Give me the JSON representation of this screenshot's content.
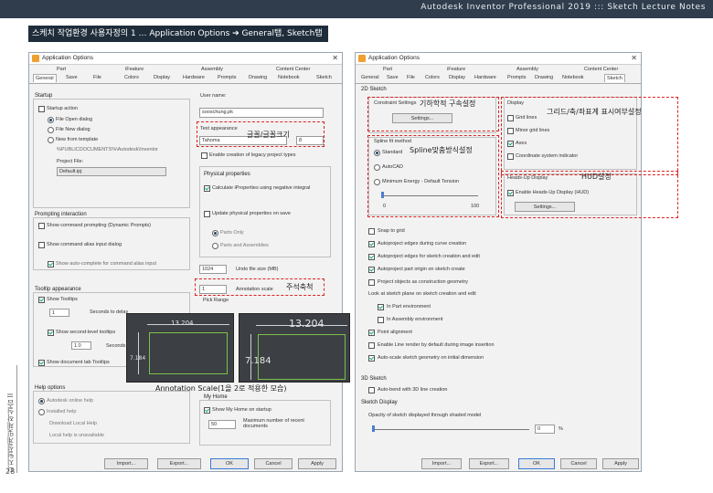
{
  "header": {
    "title": "Autodesk Inventor Professional 2019 ::: Sketch Lecture Notes"
  },
  "slide": {
    "heading": "스케치 작업환경 사용자정의 1 … Application Options ➔ General탭, Sketch탭",
    "sidebar_text": "디지털설계및제작실습 II",
    "page_number": "28"
  },
  "left_dialog": {
    "title": "Application Options",
    "close": "✕",
    "tabs_row1": [
      "Part",
      "iFeature",
      "Assembly",
      "Content Center"
    ],
    "tabs_row2": [
      "General",
      "Save",
      "File",
      "Colors",
      "Display",
      "Hardware",
      "Prompts",
      "Drawing",
      "Notebook",
      "Sketch"
    ],
    "startup": {
      "group": "Startup",
      "startup_action": "Startup action",
      "file_open": "File Open dialog",
      "file_new": "File New dialog",
      "new_from_template": "New from template",
      "template_path": "%PUBLICDOCUMENTS%\\Autodesk\\Inventor",
      "project_file_label": "Project File:",
      "project_file_value": "Default.ipj"
    },
    "user_name_label": "User name:",
    "user_name_value": "sooschung.pk",
    "text_appearance_label": "Text appearance",
    "font_value": "Tahoma",
    "font_size": "8",
    "enable_creation_label": "Enable creation of legacy project types",
    "physical_props": {
      "group": "Physical properties",
      "calc_label": "Calculate iProperties using negative integral",
      "update_label": "Update physical properties on save",
      "parts_only": "Parts Only",
      "parts_assemblies": "Parts and Assemblies"
    },
    "prompting": {
      "group": "Prompting interaction",
      "show_command": "Show command prompting (Dynamic Prompts)",
      "show_command_alias": "Show command alias input dialog",
      "show_auto_complete": "Show auto-complete for command alias input"
    },
    "undo_value": "1024",
    "undo_label": "Undo file size (MB)",
    "annotation_scale_value": "1",
    "annotation_scale_label": "Annotation scale",
    "pick_range": "Pick Range",
    "tooltip": {
      "group": "Tooltip appearance",
      "show_tooltips": "Show Tooltips",
      "delay_value": "1",
      "seconds_delay": "Seconds to delay",
      "show_second_level": "Show second-level tooltips",
      "delay2_value": "1.0",
      "seconds_delay2": "Seconds to delay",
      "show_doc_tab": "Show document tab Tooltips"
    },
    "help": {
      "group": "Help options",
      "autodesk_help": "Autodesk online help",
      "installed_help": "Installed help",
      "download_help": "Download Local Help",
      "local_help_note": "Local help is unavailable"
    },
    "my_home": {
      "group": "My Home",
      "show_my_home": "Show My Home on startup",
      "recent_value": "50",
      "recent_label": "Maximum number of recent documents"
    },
    "buttons": {
      "import": "Import...",
      "export": "Export...",
      "ok": "OK",
      "cancel": "Cancel",
      "apply": "Apply"
    }
  },
  "right_dialog": {
    "title": "Application Options",
    "close": "✕",
    "tabs_row1": [
      "Part",
      "iFeature",
      "Assembly",
      "Content Center"
    ],
    "tabs_row2": [
      "General",
      "Save",
      "File",
      "Colors",
      "Display",
      "Hardware",
      "Prompts",
      "Drawing",
      "Notebook",
      "Sketch"
    ],
    "sketch_2d": "2D Sketch",
    "constraint_settings": "Constraint Settings",
    "settings_btn": "Settings...",
    "display_group": "Display",
    "grid_lines": "Grid lines",
    "minor_grid": "Minor grid lines",
    "axes": "Axes",
    "coord_indicator": "Coordinate system indicator",
    "spline_fit": "Spline fit method",
    "standard": "Standard",
    "autocad": "AutoCAD",
    "min_energy": "Minimum Energy - Default Tension",
    "slider_min": "0",
    "slider_max": "100",
    "hud_group": "Heads-Up Display",
    "enable_hud": "Enable Heads-Up Display (HUD)",
    "hud_settings": "Settings...",
    "snap_to_grid": "Snap to grid",
    "options": [
      "Autoproject edges during curve creation",
      "Autoproject edges for sketch creation and edit",
      "Autoproject part origin on sketch create",
      "Project objects as construction geometry",
      "Look at sketch plane on sketch creation and edit",
      "In Part environment",
      "In Assembly environment",
      "Point alignment",
      "Enable Line render by default during image insertion",
      "Auto-scale sketch geometry on initial dimension"
    ],
    "sketch_3d": "3D Sketch",
    "auto_bend": "Auto-bend with 3D line creation",
    "sketch_display": "Sketch Display",
    "opacity_label": "Opacity of sketch displayed through shaded model",
    "opacity_value": "0",
    "opacity_unit": "%",
    "buttons": {
      "import": "Import...",
      "export": "Export...",
      "ok": "OK",
      "cancel": "Cancel",
      "apply": "Apply"
    }
  },
  "annotations": {
    "constraint": "기하학적 구속설정",
    "grid": "그리드/축/좌표계 표시여부설정",
    "font": "글꼴/글꼴크기",
    "spline": "Spline맞춤방식설정",
    "hud": "HUD설정",
    "annotation": "주석축척",
    "annotation_caption": "Annotation Scale(1을 2로 적용한 모습)"
  },
  "preview": {
    "small_dim_h": "13.204",
    "small_dim_v": "7.184",
    "large_dim_h": "13.204",
    "large_dim_v": "7.184"
  }
}
